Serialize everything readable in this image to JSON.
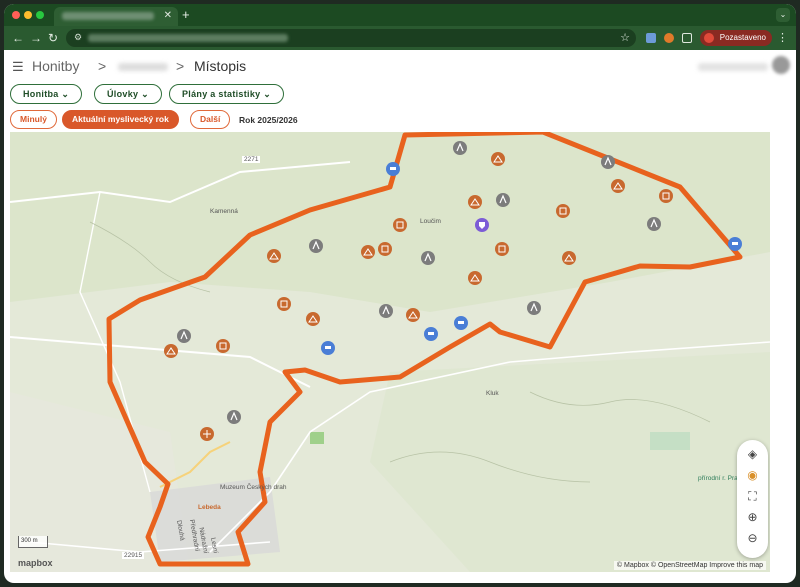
{
  "browser": {
    "profile_label": "Pozastaveno",
    "colors": {
      "tabbar": "#1c4a22",
      "addrbar": "#2a5a30"
    }
  },
  "header": {
    "root_crumb": "Honitby",
    "separator": ">",
    "current_page": "Místopis"
  },
  "menus": [
    {
      "label": "Honitba"
    },
    {
      "label": "Úlovky"
    },
    {
      "label": "Plány a statistiky"
    }
  ],
  "year_nav": {
    "prev_label": "Minulý",
    "current_label": "Aktuální myslivecký rok",
    "next_label": "Další",
    "year_text": "Rok 2025/2026"
  },
  "map": {
    "attribution": "© Mapbox © OpenStreetMap  Improve this map",
    "logo_text": "mapbox",
    "scale_text": "300 m",
    "place_labels": [
      {
        "text": "Kamenná"
      },
      {
        "text": "Loučim"
      },
      {
        "text": "Kluk"
      },
      {
        "text": "Muzeum Českých drah"
      },
      {
        "text": "Lebeda"
      },
      {
        "text": "přírodní r. Pramény"
      },
      {
        "text": "2271"
      },
      {
        "text": "22915"
      }
    ],
    "road_labels": [
      {
        "text": "Dlouhá"
      },
      {
        "text": "Předhradní"
      },
      {
        "text": "Nádražní"
      },
      {
        "text": "Lesní"
      }
    ],
    "colors": {
      "boundary": "#e8621e",
      "marker_orange": "#c8692f",
      "marker_grey": "#7c7c7c",
      "marker_blue": "#4a7ed6"
    },
    "markers": [
      {
        "type": "tower",
        "color": "grey"
      },
      {
        "type": "feeder",
        "color": "orange"
      },
      {
        "type": "shelter",
        "color": "orange"
      },
      {
        "type": "blue-station",
        "color": "blue"
      },
      {
        "type": "shield",
        "color": "purple"
      }
    ]
  },
  "controls": [
    {
      "name": "layers-icon"
    },
    {
      "name": "eye-icon"
    },
    {
      "name": "fullscreen-icon"
    },
    {
      "name": "zoom-in-icon"
    },
    {
      "name": "zoom-out-icon"
    }
  ]
}
